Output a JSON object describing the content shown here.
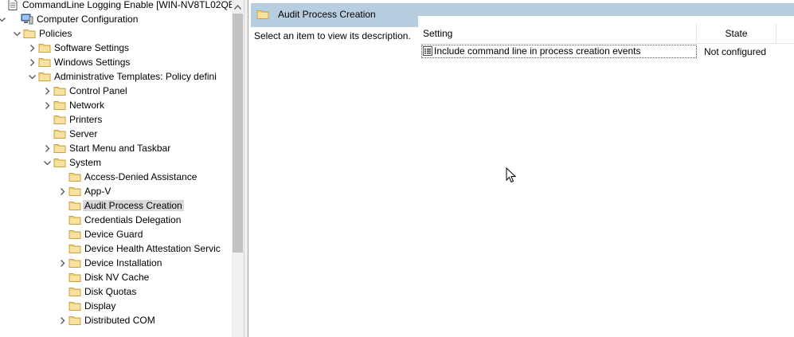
{
  "tree": {
    "items": [
      {
        "label": "CommandLine Logging Enable [WIN-NV8TL02QE",
        "icon": "policy-document-icon",
        "chevron": "none",
        "level": 0
      },
      {
        "label": "Computer Configuration",
        "icon": "computer-icon",
        "chevron": "expanded",
        "level": 0
      },
      {
        "label": "Policies",
        "icon": "folder-icon",
        "chevron": "expanded",
        "level": 1
      },
      {
        "label": "Software Settings",
        "icon": "folder-icon",
        "chevron": "collapsed",
        "level": 2
      },
      {
        "label": "Windows Settings",
        "icon": "folder-icon",
        "chevron": "collapsed",
        "level": 2
      },
      {
        "label": "Administrative Templates: Policy defini",
        "icon": "folder-icon",
        "chevron": "expanded",
        "level": 2
      },
      {
        "label": "Control Panel",
        "icon": "folder-icon",
        "chevron": "collapsed",
        "level": 3
      },
      {
        "label": "Network",
        "icon": "folder-icon",
        "chevron": "collapsed",
        "level": 3
      },
      {
        "label": "Printers",
        "icon": "folder-icon",
        "chevron": "none",
        "level": 3
      },
      {
        "label": "Server",
        "icon": "folder-icon",
        "chevron": "none",
        "level": 3
      },
      {
        "label": "Start Menu and Taskbar",
        "icon": "folder-icon",
        "chevron": "collapsed",
        "level": 3
      },
      {
        "label": "System",
        "icon": "folder-icon",
        "chevron": "expanded",
        "level": 3
      },
      {
        "label": "Access-Denied Assistance",
        "icon": "folder-icon",
        "chevron": "none",
        "level": 4
      },
      {
        "label": "App-V",
        "icon": "folder-icon",
        "chevron": "collapsed",
        "level": 4
      },
      {
        "label": "Audit Process Creation",
        "icon": "folder-icon",
        "chevron": "none",
        "level": 4,
        "selected": true
      },
      {
        "label": "Credentials Delegation",
        "icon": "folder-icon",
        "chevron": "none",
        "level": 4
      },
      {
        "label": "Device Guard",
        "icon": "folder-icon",
        "chevron": "none",
        "level": 4
      },
      {
        "label": "Device Health Attestation Servic",
        "icon": "folder-icon",
        "chevron": "none",
        "level": 4
      },
      {
        "label": "Device Installation",
        "icon": "folder-icon",
        "chevron": "collapsed",
        "level": 4
      },
      {
        "label": "Disk NV Cache",
        "icon": "folder-icon",
        "chevron": "none",
        "level": 4
      },
      {
        "label": "Disk Quotas",
        "icon": "folder-icon",
        "chevron": "none",
        "level": 4
      },
      {
        "label": "Display",
        "icon": "folder-icon",
        "chevron": "none",
        "level": 4
      },
      {
        "label": "Distributed COM",
        "icon": "folder-icon",
        "chevron": "collapsed",
        "level": 4
      }
    ]
  },
  "details": {
    "title": "Audit Process Creation",
    "title_icon": "folder-icon",
    "description": "Select an item to view its description.",
    "columns": {
      "setting": "Setting",
      "state": "State"
    },
    "rows": [
      {
        "setting": "Include command line in process creation events",
        "state": "Not configured",
        "icon": "policy-setting-icon"
      }
    ]
  },
  "colors": {
    "header_band": "#b7cde0",
    "selection": "#d9d9d9",
    "folder": "#e8c46a"
  }
}
